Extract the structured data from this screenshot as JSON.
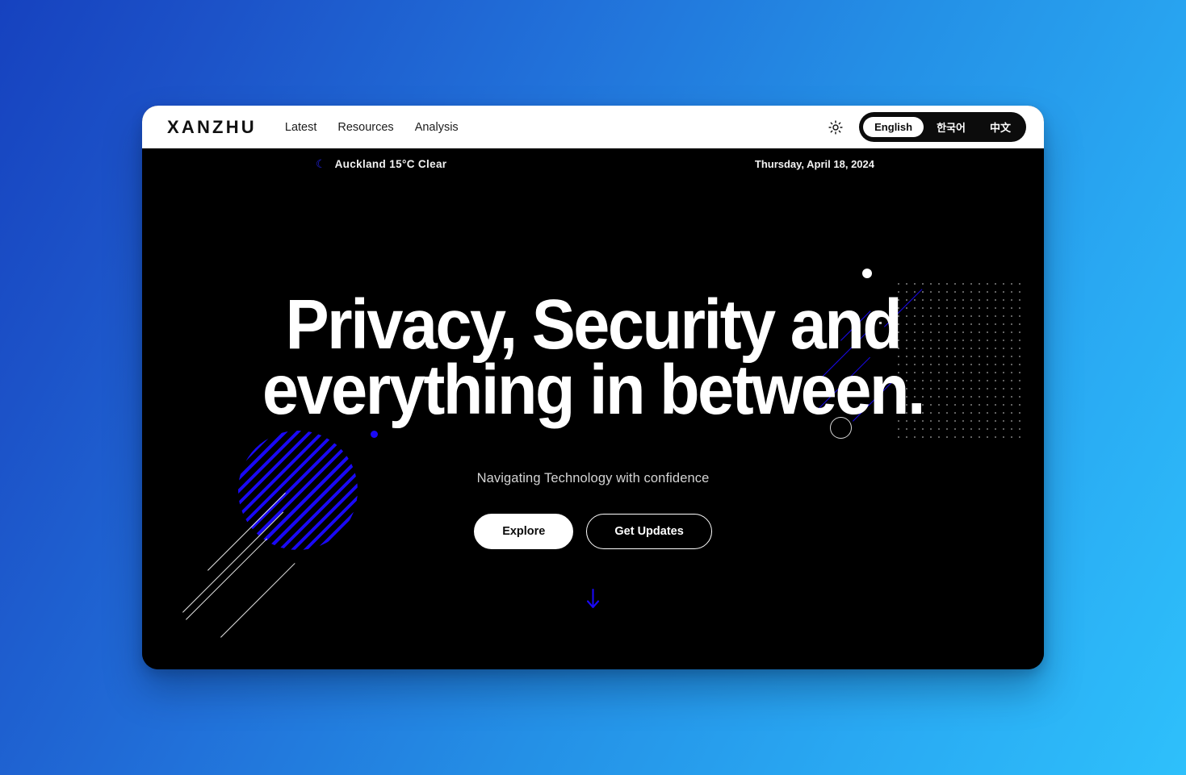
{
  "site": {
    "brand": "XANZHU",
    "nav": [
      {
        "label": "Latest"
      },
      {
        "label": "Resources"
      },
      {
        "label": "Analysis"
      }
    ],
    "theme_toggle_icon": "sun-icon",
    "languages": [
      {
        "label": "English",
        "active": true
      },
      {
        "label": "한국어",
        "active": false
      },
      {
        "label": "中文",
        "active": false
      }
    ]
  },
  "info_bar": {
    "weather_icon": "crescent-moon-icon",
    "weather": "Auckland  15°C  Clear",
    "date": "Thursday, April 18, 2024"
  },
  "hero": {
    "title": "Privacy, Security and\neverything in between.",
    "subtitle": "Navigating Technology with confidence",
    "primary_cta": "Explore",
    "secondary_cta": "Get Updates",
    "scroll_indicator_icon": "arrow-down-icon"
  },
  "colors": {
    "accent_blue": "#1a09f5",
    "page_background_start": "#1642bf",
    "page_background_end": "#2ec0fb",
    "hero_background": "#000000",
    "header_background": "#ffffff"
  }
}
